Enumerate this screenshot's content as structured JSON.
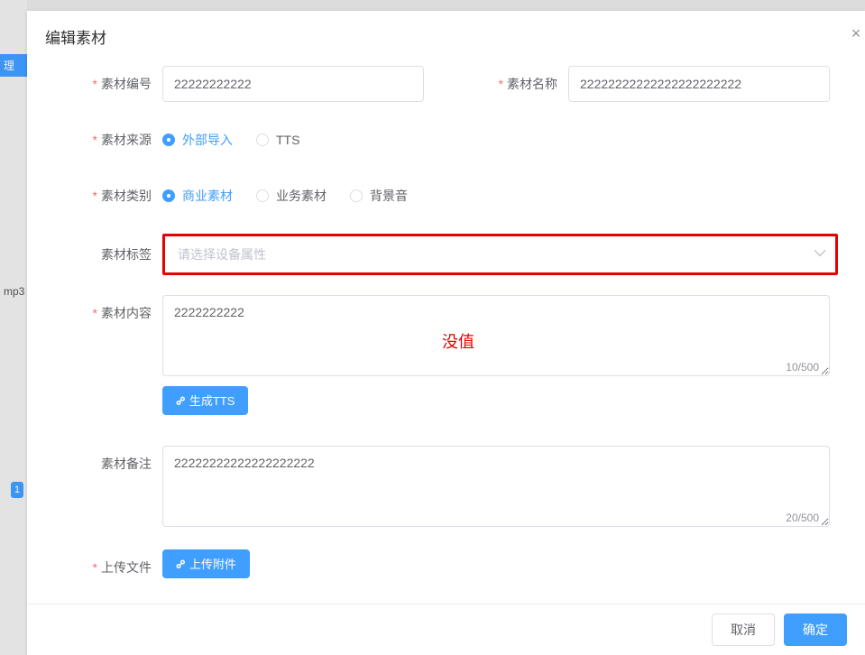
{
  "dialog": {
    "title": "编辑素材",
    "cancel": "取消",
    "confirm": "确定"
  },
  "annotation": {
    "no_value": "没值",
    "highlight_color": "#E60000"
  },
  "bg": {
    "sb_li": "理",
    "sb_mp3": "mp3",
    "sb_page": "1"
  },
  "fields": {
    "id": {
      "label": "素材编号",
      "value": "22222222222"
    },
    "name": {
      "label": "素材名称",
      "value": "22222222222222222222222"
    },
    "source": {
      "label": "素材来源",
      "options": [
        "外部导入",
        "TTS"
      ],
      "selected": 0
    },
    "category": {
      "label": "素材类别",
      "options": [
        "商业素材",
        "业务素材",
        "背景音"
      ],
      "selected": 0
    },
    "tags": {
      "label": "素材标签",
      "placeholder": "请选择设备属性",
      "value": ""
    },
    "content": {
      "label": "素材内容",
      "value": "2222222222",
      "counter": "10/500"
    },
    "remark": {
      "label": "素材备注",
      "value": "22222222222222222222",
      "counter": "20/500"
    },
    "upload": {
      "label": "上传文件"
    }
  },
  "buttons": {
    "gen_tts": "生成TTS",
    "upload_attachment": "上传附件"
  }
}
